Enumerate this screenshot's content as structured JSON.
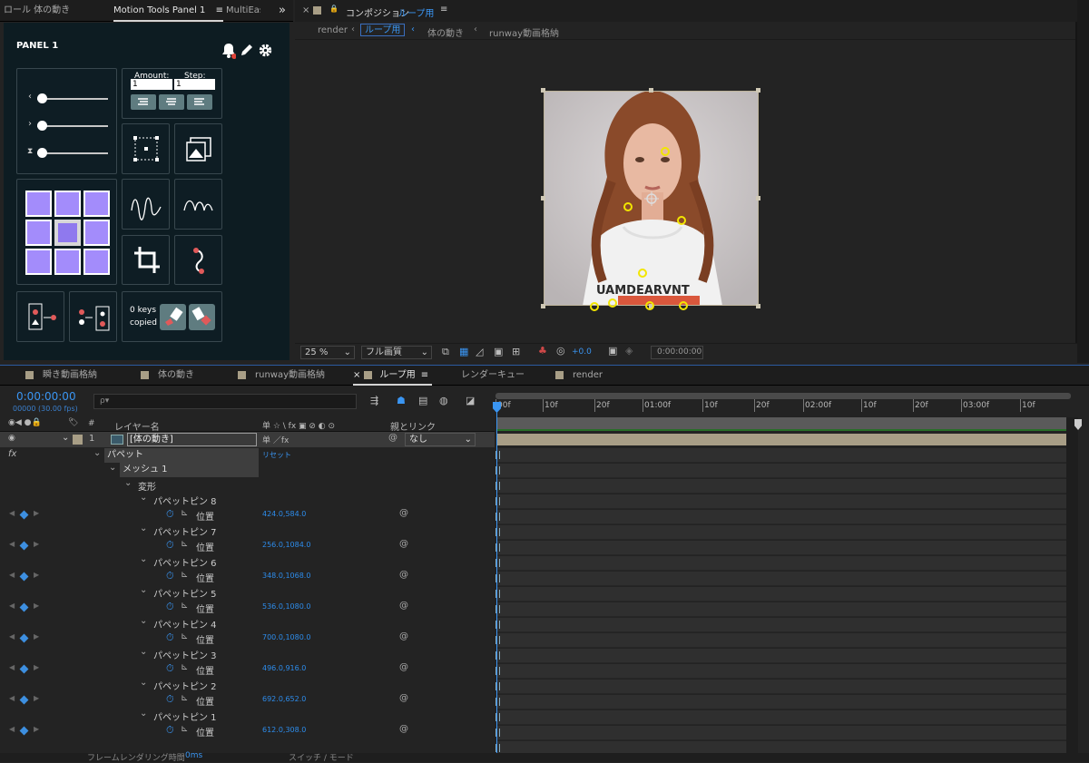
{
  "left_tabs": {
    "tab1": "ロール 体の動き",
    "tab2": "Motion Tools Panel 1",
    "tab2_menu": "≡",
    "tab3": "MultiEase",
    "more": "»"
  },
  "panel1": {
    "title": "PANEL 1",
    "amount_label": "Amount:",
    "amount_value": "1",
    "step_label": "Step:",
    "step_value": "1",
    "keys_copied_line1": "0 keys",
    "keys_copied_line2": "copied"
  },
  "comp": {
    "close": "×",
    "lock": "🔒",
    "title_prefix": "コンポジション",
    "title_name": "ループ用",
    "menu": "≡",
    "breadcrumbs": [
      {
        "label": "render"
      },
      {
        "label": "ループ用"
      },
      {
        "label": "体の動き"
      },
      {
        "label": "runway動画格納"
      }
    ],
    "artwork_text": "UAMDEARVNT"
  },
  "viewer_toolbar": {
    "zoom": "25 %",
    "quality": "フル画質",
    "exposure": "+0.0",
    "timecode": "0:00:00:00"
  },
  "timeline_tabs": [
    {
      "label": "瞬き動画格納"
    },
    {
      "label": "体の動き"
    },
    {
      "label": "runway動画格納"
    },
    {
      "label": "ループ用"
    },
    {
      "label": "レンダーキュー"
    },
    {
      "label": "render"
    }
  ],
  "timeline_tab_close": "×",
  "timeline_tab_menu": "≡",
  "timeline": {
    "timecode": "0:00:00:00",
    "frame_info": "00000 (30.00 fps)",
    "search_placeholder": "ρ▾",
    "col_num": "#",
    "col_layer_name": "レイヤー名",
    "col_switches": "单 ☆ \\ fx ▣ ⊘ ◐ ⊙",
    "col_parent": "親とリンク",
    "layer1": {
      "num": "1",
      "name": "[体の動き]",
      "parent": "なし",
      "switches": "单 ／fx"
    },
    "fx": "fx",
    "puppet": "パペット",
    "reset": "リセット",
    "mesh": "メッシュ 1",
    "deform": "変形",
    "prop_label": "位置",
    "pins": [
      {
        "name": "パペットピン 8",
        "value": "424.0,584.0"
      },
      {
        "name": "パペットピン 7",
        "value": "256.0,1084.0"
      },
      {
        "name": "パペットピン 6",
        "value": "348.0,1068.0"
      },
      {
        "name": "パペットピン 5",
        "value": "536.0,1080.0"
      },
      {
        "name": "パペットピン 4",
        "value": "700.0,1080.0"
      },
      {
        "name": "パペットピン 3",
        "value": "496.0,916.0"
      },
      {
        "name": "パペットピン 2",
        "value": "692.0,652.0"
      },
      {
        "name": "パペットピン 1",
        "value": "612.0,308.0"
      }
    ],
    "ruler": [
      "00f",
      "10f",
      "20f",
      "01:00f",
      "10f",
      "20f",
      "02:00f",
      "10f",
      "20f",
      "03:00f",
      "10f"
    ],
    "bottom_text1": "フレームレンダリング時間",
    "bottom_text1_value": "0ms",
    "bottom_text2": "スイッチ / モード"
  },
  "colors": {
    "accent": "#2d8ceb",
    "pin": "#f2e600",
    "panel": "#0d1c22",
    "grid": "#a38cfb"
  }
}
